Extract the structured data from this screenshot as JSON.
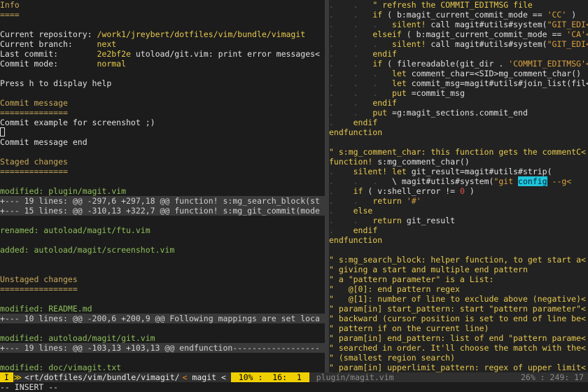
{
  "left_pane": {
    "info_title": "Info",
    "info_rule": "====",
    "rows": [
      {
        "label": "Current repository: ",
        "value": "/work1/jreybert/dotfiles/vim/bundle/vimagit"
      },
      {
        "label": "Current branch:     ",
        "value": "next"
      },
      {
        "label": "Last commit:        ",
        "value": "2e2bf2e",
        "extra": " utoload/git.vim: print error messages<"
      },
      {
        "label": "Commit mode:        ",
        "value": "normal"
      }
    ],
    "help_text": "Press h to display help",
    "commit_title": "Commit message",
    "commit_rule": "==============",
    "commit_line": "Commit example for screenshot ;)",
    "commit_end": "Commit message end",
    "staged_title": "Staged changes",
    "staged_rule": "==============",
    "staged_file1": "modified: plugin/magit.vim",
    "staged_fold1": "+--- 19 lines: @@ -297,6 +297,18 @@ function! s:mg_search_block(st",
    "staged_fold2": "+--- 15 lines: @@ -310,13 +322,7 @@ function! s:mg_git_commit(mode",
    "staged_file2": "renamed: autoload/magit/ftu.vim",
    "staged_file3": "added: autoload/magit/screenshot.vim",
    "unstaged_title": "Unstaged changes",
    "unstaged_rule": "================",
    "unstaged_file1": "modified: README.md",
    "unstaged_fold1": "+--- 10 lines: @@ -200,6 +200,9 @@ Following mappings are set loca",
    "unstaged_file2": "modified: autoload/magit/git.vim",
    "unstaged_fold2": "+--- 19 lines: @@ -103,13 +103,13 @@ endfunction------------------",
    "unstaged_file3": "modified: doc/vimagit.txt"
  },
  "right_pane": {
    "lines": [
      [
        {
          "t": ".    .   ",
          "c": "code-ind"
        },
        {
          "t": "\" refresh the COMMIT_EDITMSG file",
          "c": "code-com"
        }
      ],
      [
        {
          "t": ".    .   ",
          "c": "code-ind"
        },
        {
          "t": "if",
          "c": "code-kw"
        },
        {
          "t": " ( b:magit_current_commit_mode == ",
          "c": "code-plain"
        },
        {
          "t": "'CC'",
          "c": "code-str"
        },
        {
          "t": " )",
          "c": "code-plain"
        }
      ],
      [
        {
          "t": ".    .   .   ",
          "c": "code-ind"
        },
        {
          "t": "silent!",
          "c": "code-kw"
        },
        {
          "t": " call magit#utils#system(",
          "c": "code-plain"
        },
        {
          "t": "\"GIT_EDI<",
          "c": "code-str"
        }
      ],
      [
        {
          "t": ".    .   ",
          "c": "code-ind"
        },
        {
          "t": "elseif",
          "c": "code-kw"
        },
        {
          "t": " ( b:magit_current_commit_mode == ",
          "c": "code-plain"
        },
        {
          "t": "'CA'<",
          "c": "code-str"
        }
      ],
      [
        {
          "t": ".    .   .   ",
          "c": "code-ind"
        },
        {
          "t": "silent!",
          "c": "code-kw"
        },
        {
          "t": " call magit#utils#system(",
          "c": "code-plain"
        },
        {
          "t": "\"GIT_EDI<",
          "c": "code-str"
        }
      ],
      [
        {
          "t": ".    .   ",
          "c": "code-ind"
        },
        {
          "t": "endif",
          "c": "code-kw"
        }
      ],
      [
        {
          "t": ".    .   ",
          "c": "code-ind"
        },
        {
          "t": "if",
          "c": "code-kw"
        },
        {
          "t": " ( filereadable(git_dir . ",
          "c": "code-plain"
        },
        {
          "t": "'COMMIT_EDITMSG'<",
          "c": "code-str"
        }
      ],
      [
        {
          "t": ".    .   .   ",
          "c": "code-ind"
        },
        {
          "t": "let",
          "c": "code-kw"
        },
        {
          "t": " comment_char=<SID>mg_comment_char()",
          "c": "code-plain"
        }
      ],
      [
        {
          "t": ".    .   .   ",
          "c": "code-ind"
        },
        {
          "t": "let",
          "c": "code-kw"
        },
        {
          "t": " commit_msg=magit#utils#join_list(fil<",
          "c": "code-plain"
        }
      ],
      [
        {
          "t": ".    .   .   ",
          "c": "code-ind"
        },
        {
          "t": "put",
          "c": "code-kw"
        },
        {
          "t": " =commit_msg",
          "c": "code-plain"
        }
      ],
      [
        {
          "t": ".    .   ",
          "c": "code-ind"
        },
        {
          "t": "endif",
          "c": "code-kw"
        }
      ],
      [
        {
          "t": ".    .   ",
          "c": "code-ind"
        },
        {
          "t": "put",
          "c": "code-kw"
        },
        {
          "t": " =g:magit_sections.commit_end",
          "c": "code-plain"
        }
      ],
      [
        {
          "t": ".    ",
          "c": "code-ind"
        },
        {
          "t": "endif",
          "c": "code-kw"
        }
      ],
      [
        {
          "t": "endfunction",
          "c": "code-kw"
        }
      ],
      [
        {
          "t": "",
          "c": "code-plain"
        }
      ],
      [
        {
          "t": "\" s:mg_comment_char: this function gets the commentC<",
          "c": "code-com"
        }
      ],
      [
        {
          "t": "function!",
          "c": "code-kw"
        },
        {
          "t": " s:mg_comment_char()",
          "c": "code-plain"
        }
      ],
      [
        {
          "t": ".    ",
          "c": "code-ind"
        },
        {
          "t": "silent!",
          "c": "code-kw"
        },
        {
          "t": " ",
          "c": "code-plain"
        },
        {
          "t": "let",
          "c": "code-kw"
        },
        {
          "t": " git_result=magit#utils#strip(",
          "c": "code-plain"
        }
      ],
      [
        {
          "t": ".    .   .   ",
          "c": "code-ind"
        },
        {
          "t": "\\ magit#utils#system(",
          "c": "code-plain"
        },
        {
          "t": "\"git ",
          "c": "code-str"
        },
        {
          "t": "config",
          "c": "code-hl"
        },
        {
          "t": " --g<",
          "c": "code-str"
        }
      ],
      [
        {
          "t": ".    ",
          "c": "code-ind"
        },
        {
          "t": "if",
          "c": "code-kw"
        },
        {
          "t": " ( v:shell_error != ",
          "c": "code-plain"
        },
        {
          "t": "0",
          "c": "code-num"
        },
        {
          "t": " )",
          "c": "code-plain"
        }
      ],
      [
        {
          "t": ".    .   ",
          "c": "code-ind"
        },
        {
          "t": "return",
          "c": "code-kw"
        },
        {
          "t": " ",
          "c": "code-plain"
        },
        {
          "t": "'#'",
          "c": "code-str"
        }
      ],
      [
        {
          "t": ".    ",
          "c": "code-ind"
        },
        {
          "t": "else",
          "c": "code-kw"
        }
      ],
      [
        {
          "t": ".    .   ",
          "c": "code-ind"
        },
        {
          "t": "return",
          "c": "code-kw"
        },
        {
          "t": " git_result",
          "c": "code-plain"
        }
      ],
      [
        {
          "t": ".    ",
          "c": "code-ind"
        },
        {
          "t": "endif",
          "c": "code-kw"
        }
      ],
      [
        {
          "t": "endfunction",
          "c": "code-kw"
        }
      ],
      [
        {
          "t": "",
          "c": "code-plain"
        }
      ],
      [
        {
          "t": "\" s:mg_search_block: helper function, to get start a<",
          "c": "code-com"
        }
      ],
      [
        {
          "t": "\" giving a start and multiple end pattern",
          "c": "code-com"
        }
      ],
      [
        {
          "t": "\" a \"pattern parameter\" is a List:",
          "c": "code-com"
        }
      ],
      [
        {
          "t": "\"   @[0]: end pattern regex",
          "c": "code-com"
        }
      ],
      [
        {
          "t": "\"   @[1]: number of line to exclude above (negative)<",
          "c": "code-com"
        }
      ],
      [
        {
          "t": "\" param[in] start_pattern: start \"pattern parameter\"<",
          "c": "code-com"
        }
      ],
      [
        {
          "t": "\" backward (cursor position is set to end of line be<",
          "c": "code-com"
        }
      ],
      [
        {
          "t": "\" pattern if on the current line)",
          "c": "code-com"
        }
      ],
      [
        {
          "t": "\" param[in] end_pattern: list of end \"pattern parame<",
          "c": "code-com"
        }
      ],
      [
        {
          "t": "\" searched in order. It'll choose the match with the<",
          "c": "code-com"
        }
      ],
      [
        {
          "t": "\" (smallest region search)",
          "c": "code-com"
        }
      ],
      [
        {
          "t": "\" param[in] upperlimit_pattern: regex of upper limit<",
          "c": "code-com"
        }
      ]
    ]
  },
  "statusline": {
    "mode": "I",
    "mode_arrow": "≫",
    "path": "<rt/dotfiles/vim/bundle/vimagit/",
    "lt": "<",
    "filetype": "magit",
    "lt2": "<",
    "position": " 10% :  16:  1 ",
    "inactive_file": "plugin/magit.vim",
    "inactive_pos": "26% : 249: 17"
  },
  "cmdline": "-- INSERT --"
}
